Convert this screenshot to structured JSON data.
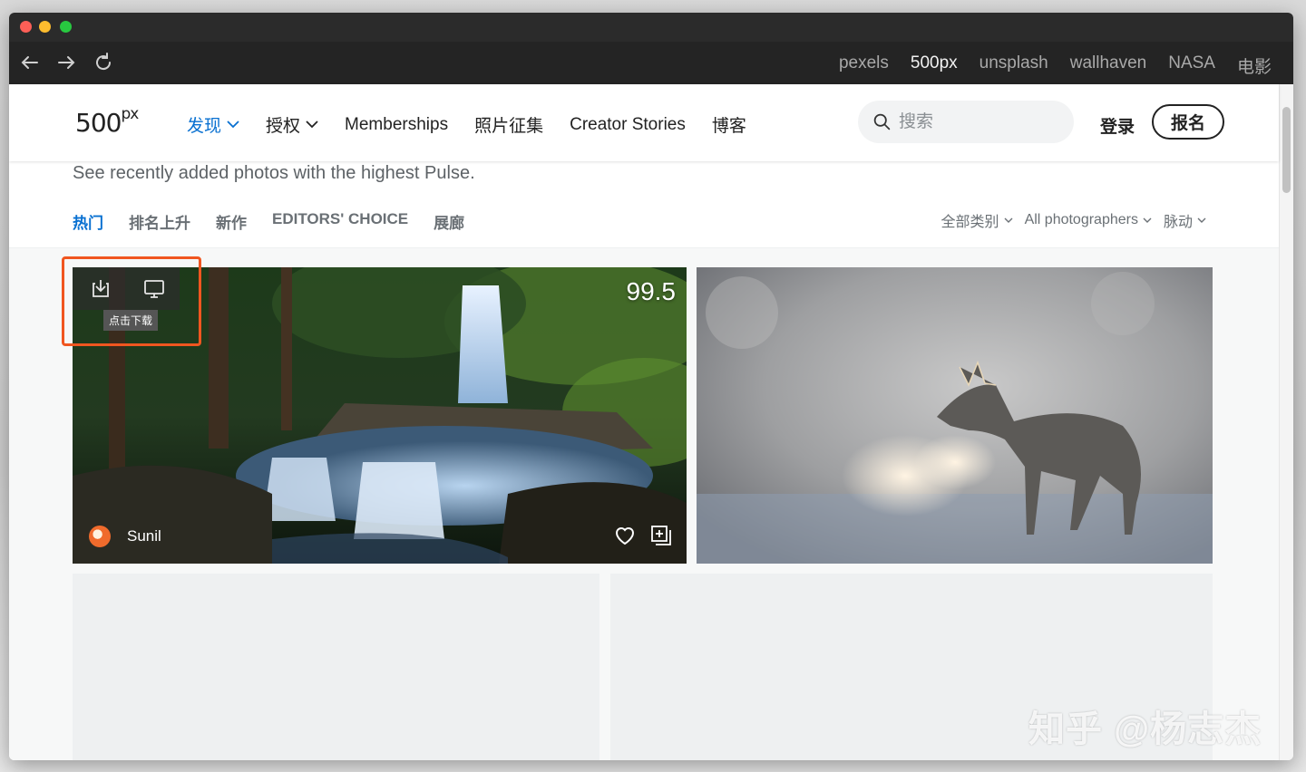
{
  "browser": {
    "bookmarks": [
      "pexels",
      "500px",
      "unsplash",
      "wallhaven",
      "NASA",
      "电影"
    ],
    "active_bookmark": "500px"
  },
  "header": {
    "logo": "500",
    "logo_suffix": "px",
    "nav": [
      "发现",
      "授权",
      "Memberships",
      "照片征集",
      "Creator Stories",
      "博客"
    ],
    "search_placeholder": "搜索",
    "login": "登录",
    "signup": "报名",
    "accent_color": "#0870d1"
  },
  "content": {
    "subtitle": "See recently added photos with the highest Pulse.",
    "tabs": [
      "热门",
      "排名上升",
      "新作",
      "EDITORS' CHOICE",
      "展廊"
    ],
    "filters": [
      "全部类别",
      "All photographers",
      "脉动"
    ]
  },
  "photos": [
    {
      "pulse": "99.5",
      "author": "Sunil",
      "tooltip": "点击下载",
      "icons": [
        "download-icon",
        "monitor-icon",
        "heart-icon",
        "add-to-gallery-icon"
      ]
    }
  ],
  "watermark": "知乎 @杨志杰"
}
